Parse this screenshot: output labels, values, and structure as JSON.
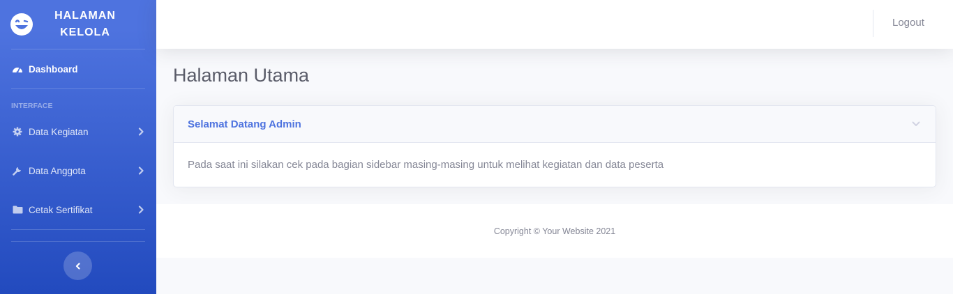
{
  "sidebar": {
    "brand": {
      "icon": "laugh-wink-icon",
      "title": "HALAMAN KELOLA"
    },
    "dashboard": {
      "label": "Dashboard",
      "icon": "tachometer-icon"
    },
    "heading": "INTERFACE",
    "items": [
      {
        "label": "Data Kegiatan",
        "icon": "cog-icon"
      },
      {
        "label": "Data Anggota",
        "icon": "wrench-icon"
      },
      {
        "label": "Cetak Sertifikat",
        "icon": "folder-icon"
      }
    ],
    "toggle_icon": "chevron-left-icon"
  },
  "topbar": {
    "logout_label": "Logout"
  },
  "page": {
    "title": "Halaman Utama"
  },
  "card": {
    "title": "Selamat Datang Admin",
    "body": "Pada saat ini silakan cek pada bagian sidebar masing-masing untuk melihat kegiatan dan data peserta"
  },
  "footer": {
    "copyright": "Copyright © Your Website 2021"
  },
  "colors": {
    "primary": "#4e73df",
    "primary_dark": "#224abe",
    "text_muted": "#858796",
    "background": "#f8f9fc"
  }
}
